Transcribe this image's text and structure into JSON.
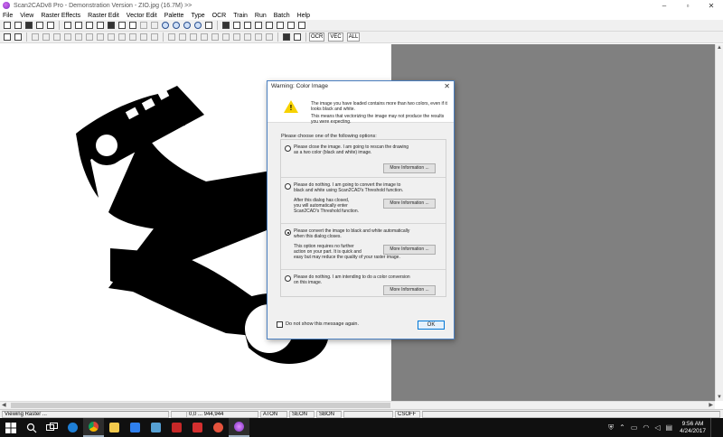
{
  "window": {
    "title": "Scan2CADv8 Pro - Demonstration Version - ZIO.jpg (16.7M) >>",
    "minimize": "–",
    "maximize": "▫",
    "close": "✕"
  },
  "menu": [
    "File",
    "View",
    "Raster Effects",
    "Raster Edit",
    "Vector Edit",
    "Palette",
    "Type",
    "OCR",
    "Train",
    "Run",
    "Batch",
    "Help"
  ],
  "toolbar2_labels": {
    "ocr": "OCR",
    "vec": "VEC",
    "all": "ALL"
  },
  "dialog": {
    "title": "Warning: Color Image",
    "close": "✕",
    "icon": "warning-icon",
    "message1": "The image you have loaded contains more than two colors, even if it looks black and white.",
    "message2": "This means that vectorizing the image may not produce the results you were expecting.",
    "choose_label": "Please choose one of the following options:",
    "options": [
      {
        "line1": "Please close the image. I am going to rescan the drawing",
        "line2": "as a two color (black and white) image.",
        "note": [
          "",
          "",
          ""
        ],
        "button": "More Information ...",
        "selected": false
      },
      {
        "line1": "Please do nothing. I am going to convert the image to",
        "line2": "black and white using Scan2CAD's Threshold function.",
        "note": [
          "After this dialog has closed,",
          "you will automatically enter",
          "Scan2CAD's Threshold function."
        ],
        "button": "More Information ...",
        "selected": false
      },
      {
        "line1": "Please convert the image to black and white automatically",
        "line2": "when this dialog closes.",
        "note": [
          "This option requires no further",
          "action on your part. It is quick and",
          "easy but may reduce the quality of your raster image."
        ],
        "button": "More Information ...",
        "selected": true
      },
      {
        "line1": "Please do nothing. I am intending to do a color conversion",
        "line2": "on this image.",
        "note": [
          "",
          "",
          ""
        ],
        "button": "More Information ...",
        "selected": false
      }
    ],
    "checkbox_label": "Do not show this message again.",
    "ok": "OK"
  },
  "status": {
    "mode": "Viewing Raster ...",
    "coords": "0,0 ... 944,944",
    "aton": "ATON",
    "seon": "SEON",
    "sbon": "SBON",
    "csoff": "CSOFF"
  },
  "taskbar": {
    "time": "9:56 AM",
    "date": "4/24/2017",
    "apps": [
      "windows-icon",
      "search-icon",
      "task-view-icon",
      "edge-icon",
      "chrome-icon",
      "file-explorer-icon",
      "store-icon",
      "photos-icon",
      "mcafee-icon",
      "app-red-icon",
      "paint-icon",
      "scan2cad-icon"
    ]
  }
}
